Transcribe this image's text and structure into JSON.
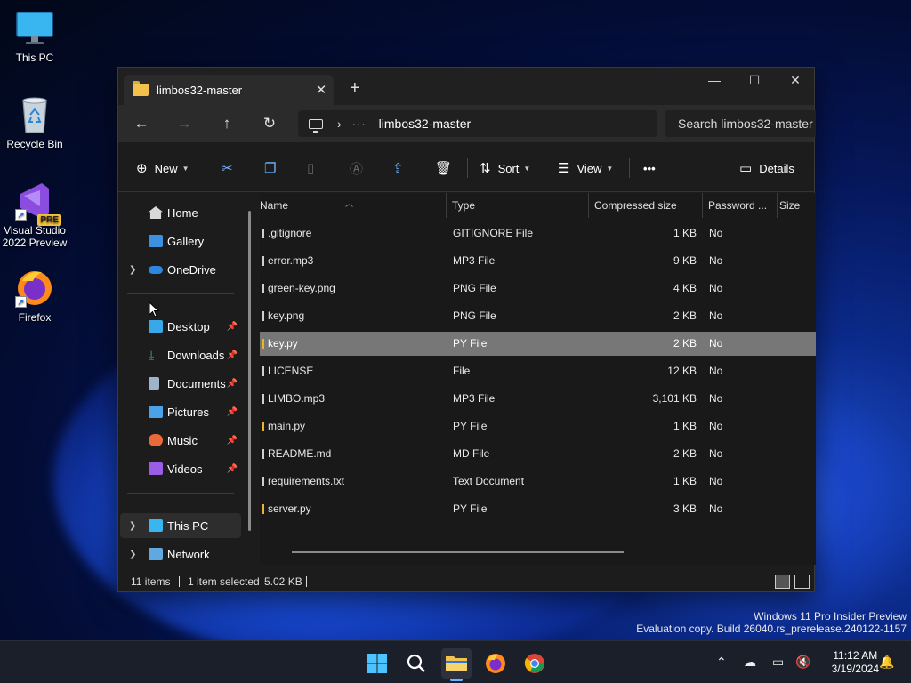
{
  "desktop": {
    "icons": [
      {
        "label": "This PC"
      },
      {
        "label": "Recycle Bin"
      },
      {
        "label": "Visual Studio 2022 Preview",
        "badge": "PRE"
      },
      {
        "label": "Firefox"
      }
    ]
  },
  "window": {
    "tab_title": "limbos32-master",
    "tab_close": "✕",
    "new_tab": "+",
    "controls": {
      "minimize": "—",
      "maximize": "☐",
      "close": "✕"
    },
    "nav": {
      "back": "←",
      "forward": "→",
      "up": "↑",
      "refresh": "↻"
    },
    "address": {
      "separator": "›",
      "overflow": "···",
      "path": "limbos32-master"
    },
    "search_placeholder": "Search limbos32-master"
  },
  "toolbar": {
    "new_label": "New",
    "sort_label": "Sort",
    "view_label": "View",
    "more_label": "•••",
    "details_label": "Details"
  },
  "navpane": {
    "items": [
      {
        "label": "Home"
      },
      {
        "label": "Gallery"
      },
      {
        "label": "OneDrive"
      },
      {
        "label": "Desktop"
      },
      {
        "label": "Downloads"
      },
      {
        "label": "Documents"
      },
      {
        "label": "Pictures"
      },
      {
        "label": "Music"
      },
      {
        "label": "Videos"
      },
      {
        "label": "This PC"
      },
      {
        "label": "Network"
      }
    ]
  },
  "filelist": {
    "columns": {
      "name": "Name",
      "type": "Type",
      "compressed": "Compressed size",
      "password": "Password ...",
      "size": "Size"
    },
    "rows": [
      {
        "name": ".gitignore",
        "type": "GITIGNORE File",
        "compressed": "1 KB",
        "password": "No"
      },
      {
        "name": "error.mp3",
        "type": "MP3 File",
        "compressed": "9 KB",
        "password": "No"
      },
      {
        "name": "green-key.png",
        "type": "PNG File",
        "compressed": "4 KB",
        "password": "No"
      },
      {
        "name": "key.png",
        "type": "PNG File",
        "compressed": "2 KB",
        "password": "No"
      },
      {
        "name": "key.py",
        "type": "PY File",
        "compressed": "2 KB",
        "password": "No"
      },
      {
        "name": "LICENSE",
        "type": "File",
        "compressed": "12 KB",
        "password": "No"
      },
      {
        "name": "LIMBO.mp3",
        "type": "MP3 File",
        "compressed": "3,101 KB",
        "password": "No"
      },
      {
        "name": "main.py",
        "type": "PY File",
        "compressed": "1 KB",
        "password": "No"
      },
      {
        "name": "README.md",
        "type": "MD File",
        "compressed": "2 KB",
        "password": "No"
      },
      {
        "name": "requirements.txt",
        "type": "Text Document",
        "compressed": "1 KB",
        "password": "No"
      },
      {
        "name": "server.py",
        "type": "PY File",
        "compressed": "3 KB",
        "password": "No"
      }
    ],
    "selected_index": 4
  },
  "status": {
    "count": "11 items",
    "selected": "1 item selected",
    "size": "5.02 KB"
  },
  "watermark": {
    "line1": "Windows 11 Pro Insider Preview",
    "line2": "Evaluation copy. Build 26040.rs_prerelease.240122-1157"
  },
  "taskbar": {
    "time": "11:12 AM",
    "date": "3/19/2024",
    "tray_chevron": "⌃"
  },
  "colors": {
    "accent": "#6fb4ff",
    "folder": "#f2c14e",
    "selection": "#777777"
  }
}
